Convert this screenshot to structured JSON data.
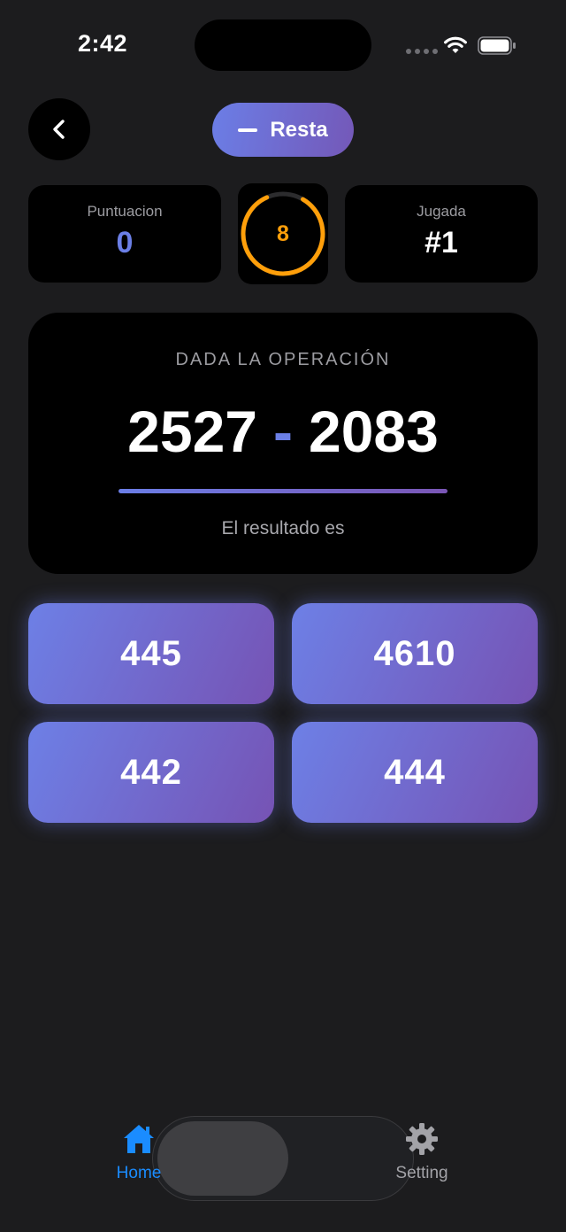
{
  "status_bar": {
    "time": "2:42"
  },
  "header": {
    "mode_label": "Resta"
  },
  "stats": {
    "score_label": "Puntuacion",
    "score_value": "0",
    "timer_value": "8",
    "round_label": "Jugada",
    "round_value": "#1"
  },
  "operation": {
    "title": "DADA LA OPERACIÓN",
    "left_operand": "2527",
    "operator": "-",
    "right_operand": "2083",
    "subtitle": "El resultado es"
  },
  "answers": [
    "445",
    "4610",
    "442",
    "444"
  ],
  "tab_bar": {
    "items": [
      {
        "label": "Home",
        "icon": "house-icon",
        "active": true
      },
      {
        "label": "Setting",
        "icon": "gear-icon",
        "active": false
      }
    ]
  },
  "colors": {
    "background": "#1c1c1e",
    "card": "#000000",
    "accent_gradient_start": "#6b7ee6",
    "accent_gradient_end": "#7458b8",
    "timer": "#ff9f0a",
    "active_tab": "#1a8cff"
  }
}
